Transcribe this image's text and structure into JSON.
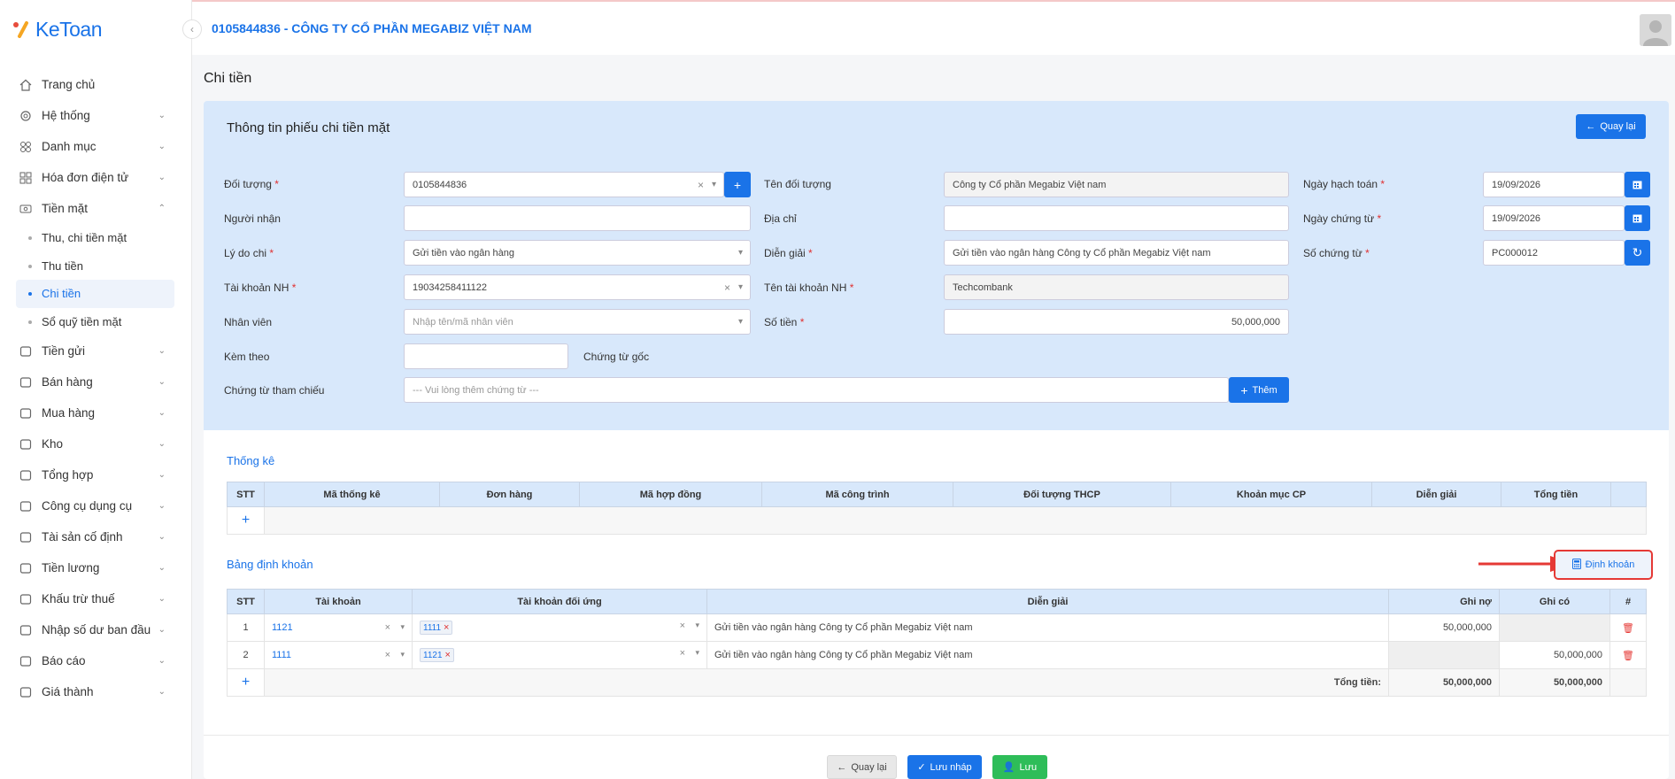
{
  "app": {
    "name": "KeToan"
  },
  "company": "0105844836 - CÔNG TY CỔ PHẦN MEGABIZ VIỆT NAM",
  "nav": [
    {
      "label": "Trang chủ",
      "icon": "home-icon",
      "chev": false
    },
    {
      "label": "Hệ thống",
      "icon": "gear-icon",
      "chev": true
    },
    {
      "label": "Danh mục",
      "icon": "grid-icon",
      "chev": true
    },
    {
      "label": "Hóa đơn điện tử",
      "icon": "invoice-icon",
      "chev": true
    },
    {
      "label": "Tiền mặt",
      "icon": "cash-icon",
      "chev": true,
      "open": true
    }
  ],
  "subnav": [
    "Thu, chi tiền mặt",
    "Thu tiền",
    "Chi tiền",
    "Sổ quỹ tiền mặt"
  ],
  "nav2": [
    "Tiền gửi",
    "Bán hàng",
    "Mua hàng",
    "Kho",
    "Tổng hợp",
    "Công cụ dụng cụ",
    "Tài sản cố định",
    "Tiền lương",
    "Khấu trừ thuế",
    "Nhập số dư ban đầu",
    "Báo cáo",
    "Giá thành"
  ],
  "page_title": "Chi tiền",
  "form": {
    "title": "Thông tin phiếu chi tiền mặt",
    "back_label": "Quay lại",
    "doi_tuong_label": "Đối tượng",
    "doi_tuong": "0105844836",
    "ten_doi_tuong_label": "Tên đối tượng",
    "ten_doi_tuong": "Công ty Cổ phần Megabiz Việt nam",
    "ngay_hach_toan_label": "Ngày hạch toán",
    "ngay_hach_toan": "19/09/2026",
    "nguoi_nhan_label": "Người nhận",
    "nguoi_nhan": "",
    "dia_chi_label": "Địa chỉ",
    "dia_chi": "",
    "ngay_chung_tu_label": "Ngày chứng từ",
    "ngay_chung_tu": "19/09/2026",
    "ly_do_chi_label": "Lý do chi",
    "ly_do_chi": "Gửi tiền vào ngân hàng",
    "dien_giai_label": "Diễn giải",
    "dien_giai": "Gửi tiền vào ngân hàng Công ty Cổ phần Megabiz Việt nam",
    "so_chung_tu_label": "Số chứng từ",
    "so_chung_tu": "PC000012",
    "tai_khoan_nh_label": "Tài khoản NH",
    "tai_khoan_nh": "19034258411122",
    "ten_tk_nh_label": "Tên tài khoản NH",
    "ten_tk_nh": "Techcombank",
    "nhan_vien_label": "Nhân viên",
    "nhan_vien_placeholder": "Nhập tên/mã nhân viên",
    "so_tien_label": "Số tiền",
    "so_tien": "50,000,000",
    "kem_theo_label": "Kèm theo",
    "kem_theo": "",
    "chung_tu_goc": "Chứng từ gốc",
    "ct_tham_chieu_label": "Chứng từ tham chiếu",
    "ct_tham_chieu_placeholder": "--- Vui lòng thêm chứng từ ---",
    "them_label": "Thêm"
  },
  "thong_ke": {
    "title": "Thống kê",
    "headers": [
      "STT",
      "Mã thống kê",
      "Đơn hàng",
      "Mã hợp đồng",
      "Mã công trình",
      "Đối tượng THCP",
      "Khoản mục CP",
      "Diễn giải",
      "Tổng tiền",
      ""
    ]
  },
  "dinh_khoan": {
    "title": "Bảng định khoản",
    "button": "Định khoản",
    "headers": [
      "STT",
      "Tài khoản",
      "Tài khoản đối ứng",
      "Diễn giải",
      "Ghi nợ",
      "Ghi có",
      "#"
    ],
    "rows": [
      {
        "stt": "1",
        "tk": "1121",
        "tk_du": "1111",
        "dien_giai": "Gửi tiền vào ngân hàng Công ty Cổ phần Megabiz Việt nam",
        "no": "50,000,000",
        "co": ""
      },
      {
        "stt": "2",
        "tk": "1111",
        "tk_du": "1121",
        "dien_giai": "Gửi tiền vào ngân hàng Công ty Cổ phần Megabiz Việt nam",
        "no": "",
        "co": "50,000,000"
      }
    ],
    "total_label": "Tổng tiền:",
    "total_no": "50,000,000",
    "total_co": "50,000,000"
  },
  "footer": {
    "back": "Quay lại",
    "draft": "Lưu nháp",
    "save": "Lưu"
  }
}
